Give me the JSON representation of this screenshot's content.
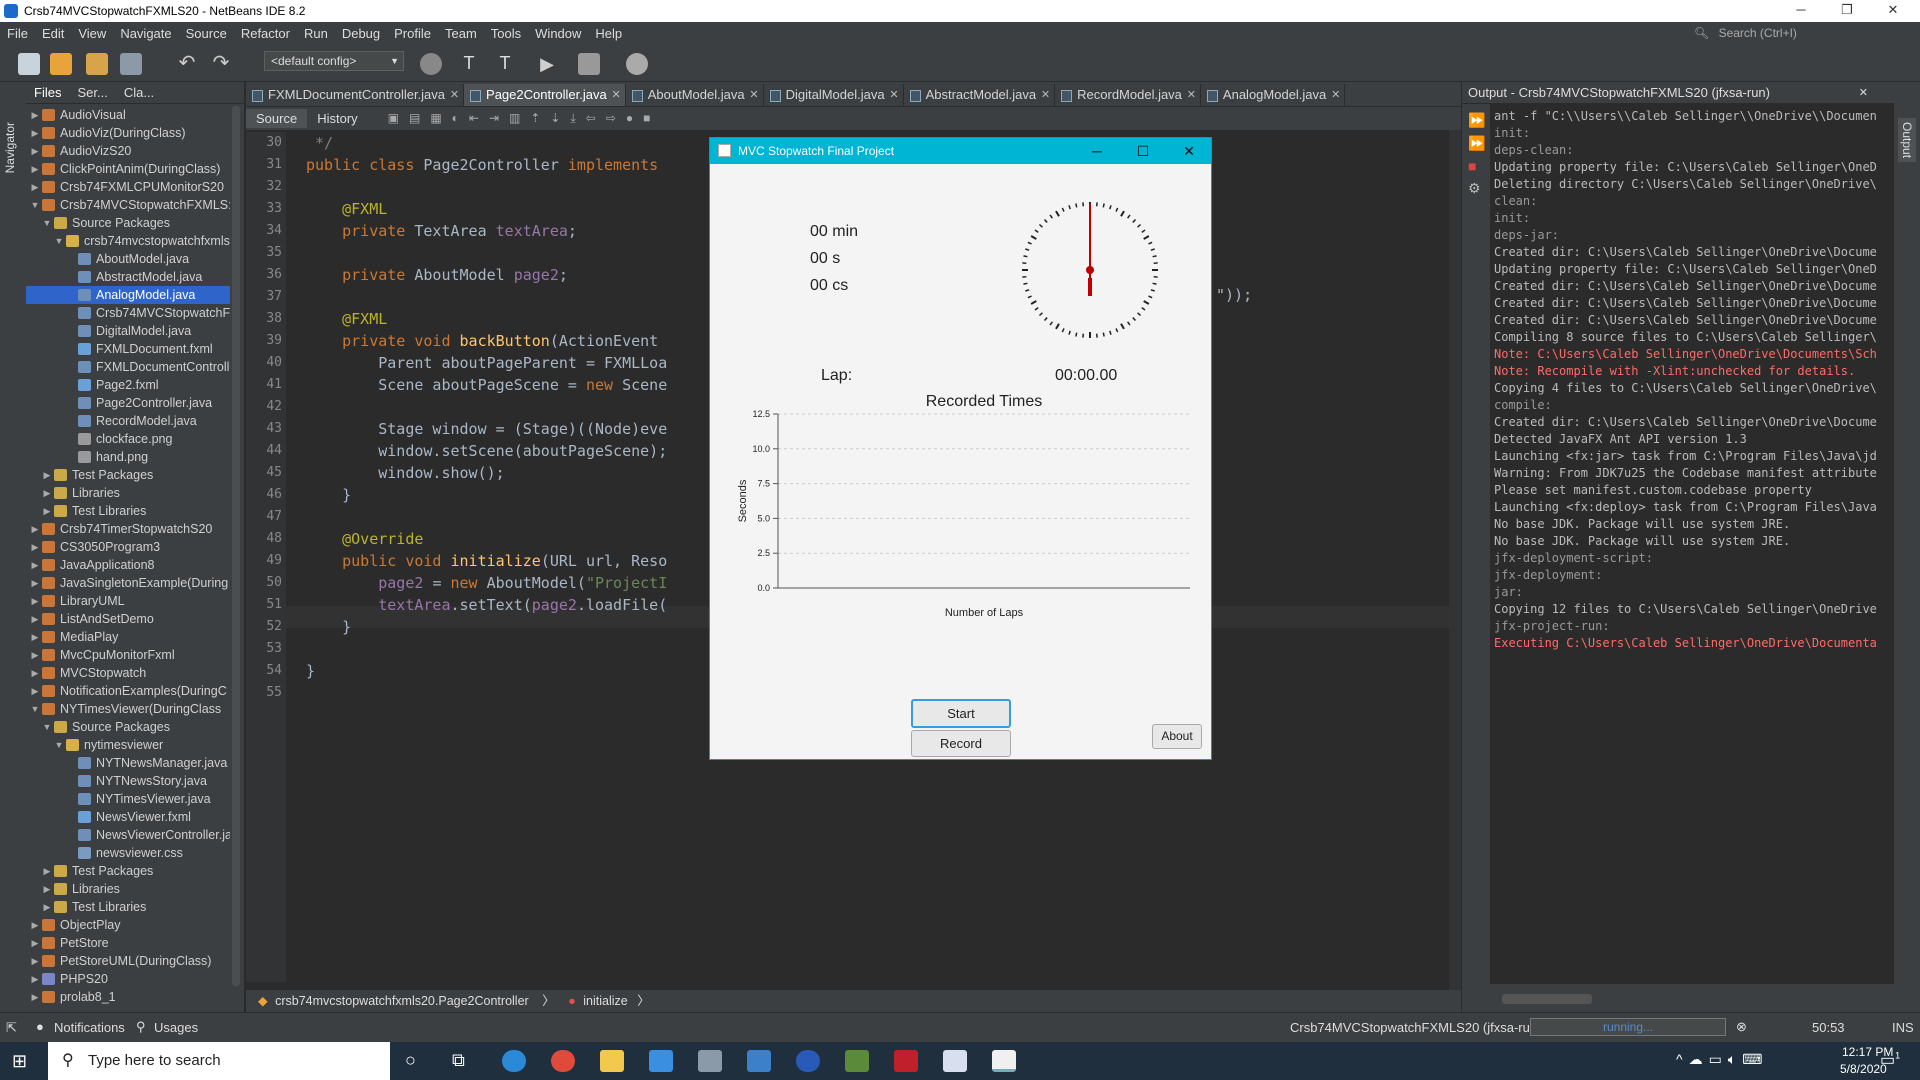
{
  "window": {
    "title": "Crsb74MVCStopwatchFXMLS20 - NetBeans IDE 8.2"
  },
  "menu": [
    "File",
    "Edit",
    "View",
    "Navigate",
    "Source",
    "Refactor",
    "Run",
    "Debug",
    "Profile",
    "Team",
    "Tools",
    "Window",
    "Help"
  ],
  "search": {
    "placeholder": "Search (Ctrl+I)"
  },
  "toolbar": {
    "config": "<default config>"
  },
  "left_strip": {
    "navigator": "Navigator"
  },
  "project_tabs": [
    "Files",
    "Ser...",
    "Cla..."
  ],
  "tree": [
    {
      "label": "AudioVisual",
      "lvl": 0,
      "arrow": "▶",
      "icon": "project-icon"
    },
    {
      "label": "AudioViz(DuringClass)",
      "lvl": 0,
      "arrow": "▶",
      "icon": "project-icon"
    },
    {
      "label": "AudioVizS20",
      "lvl": 0,
      "arrow": "▶",
      "icon": "project-icon"
    },
    {
      "label": "ClickPointAnim(DuringClass)",
      "lvl": 0,
      "arrow": "▶",
      "icon": "project-icon"
    },
    {
      "label": "Crsb74FXMLCPUMonitorS20",
      "lvl": 0,
      "arrow": "▶",
      "icon": "project-icon"
    },
    {
      "label": "Crsb74MVCStopwatchFXMLS:",
      "lvl": 0,
      "arrow": "▼",
      "icon": "project-icon"
    },
    {
      "label": "Source Packages",
      "lvl": 1,
      "arrow": "▼",
      "icon": "folder-icon"
    },
    {
      "label": "crsb74mvcstopwatchfxmls:",
      "lvl": 2,
      "arrow": "▼",
      "icon": "package-icon"
    },
    {
      "label": "AboutModel.java",
      "lvl": 3,
      "arrow": "",
      "icon": "java-file-icon"
    },
    {
      "label": "AbstractModel.java",
      "lvl": 3,
      "arrow": "",
      "icon": "java-file-icon"
    },
    {
      "label": "AnalogModel.java",
      "lvl": 3,
      "arrow": "",
      "icon": "java-file-icon",
      "sel": true
    },
    {
      "label": "Crsb74MVCStopwatchFX",
      "lvl": 3,
      "arrow": "",
      "icon": "java-file-icon"
    },
    {
      "label": "DigitalModel.java",
      "lvl": 3,
      "arrow": "",
      "icon": "java-file-icon"
    },
    {
      "label": "FXMLDocument.fxml",
      "lvl": 3,
      "arrow": "",
      "icon": "fxml-file-icon"
    },
    {
      "label": "FXMLDocumentControlle",
      "lvl": 3,
      "arrow": "",
      "icon": "java-file-icon"
    },
    {
      "label": "Page2.fxml",
      "lvl": 3,
      "arrow": "",
      "icon": "fxml-file-icon"
    },
    {
      "label": "Page2Controller.java",
      "lvl": 3,
      "arrow": "",
      "icon": "java-file-icon"
    },
    {
      "label": "RecordModel.java",
      "lvl": 3,
      "arrow": "",
      "icon": "java-file-icon"
    },
    {
      "label": "clockface.png",
      "lvl": 3,
      "arrow": "",
      "icon": "image-file-icon"
    },
    {
      "label": "hand.png",
      "lvl": 3,
      "arrow": "",
      "icon": "image-file-icon"
    },
    {
      "label": "Test Packages",
      "lvl": 1,
      "arrow": "▶",
      "icon": "folder-icon"
    },
    {
      "label": "Libraries",
      "lvl": 1,
      "arrow": "▶",
      "icon": "folder-icon"
    },
    {
      "label": "Test Libraries",
      "lvl": 1,
      "arrow": "▶",
      "icon": "folder-icon"
    },
    {
      "label": "Crsb74TimerStopwatchS20",
      "lvl": 0,
      "arrow": "▶",
      "icon": "project-icon"
    },
    {
      "label": "CS3050Program3",
      "lvl": 0,
      "arrow": "▶",
      "icon": "project-icon"
    },
    {
      "label": "JavaApplication8",
      "lvl": 0,
      "arrow": "▶",
      "icon": "project-icon"
    },
    {
      "label": "JavaSingletonExample(During",
      "lvl": 0,
      "arrow": "▶",
      "icon": "project-icon"
    },
    {
      "label": "LibraryUML",
      "lvl": 0,
      "arrow": "▶",
      "icon": "project-icon"
    },
    {
      "label": "ListAndSetDemo",
      "lvl": 0,
      "arrow": "▶",
      "icon": "project-icon"
    },
    {
      "label": "MediaPlay",
      "lvl": 0,
      "arrow": "▶",
      "icon": "project-icon"
    },
    {
      "label": "MvcCpuMonitorFxml",
      "lvl": 0,
      "arrow": "▶",
      "icon": "project-icon"
    },
    {
      "label": "MVCStopwatch",
      "lvl": 0,
      "arrow": "▶",
      "icon": "project-icon"
    },
    {
      "label": "NotificationExamples(DuringC",
      "lvl": 0,
      "arrow": "▶",
      "icon": "project-icon"
    },
    {
      "label": "NYTimesViewer(DuringClass",
      "lvl": 0,
      "arrow": "▼",
      "icon": "project-icon"
    },
    {
      "label": "Source Packages",
      "lvl": 1,
      "arrow": "▼",
      "icon": "folder-icon"
    },
    {
      "label": "nytimesviewer",
      "lvl": 2,
      "arrow": "▼",
      "icon": "package-icon"
    },
    {
      "label": "NYTNewsManager.java",
      "lvl": 3,
      "arrow": "",
      "icon": "java-file-icon"
    },
    {
      "label": "NYTNewsStory.java",
      "lvl": 3,
      "arrow": "",
      "icon": "java-file-icon"
    },
    {
      "label": "NYTimesViewer.java",
      "lvl": 3,
      "arrow": "",
      "icon": "java-file-icon"
    },
    {
      "label": "NewsViewer.fxml",
      "lvl": 3,
      "arrow": "",
      "icon": "fxml-file-icon"
    },
    {
      "label": "NewsViewerController.ja",
      "lvl": 3,
      "arrow": "",
      "icon": "java-file-icon"
    },
    {
      "label": "newsviewer.css",
      "lvl": 3,
      "arrow": "",
      "icon": "css-file-icon"
    },
    {
      "label": "Test Packages",
      "lvl": 1,
      "arrow": "▶",
      "icon": "folder-icon"
    },
    {
      "label": "Libraries",
      "lvl": 1,
      "arrow": "▶",
      "icon": "folder-icon"
    },
    {
      "label": "Test Libraries",
      "lvl": 1,
      "arrow": "▶",
      "icon": "folder-icon"
    },
    {
      "label": "ObjectPlay",
      "lvl": 0,
      "arrow": "▶",
      "icon": "project-icon"
    },
    {
      "label": "PetStore",
      "lvl": 0,
      "arrow": "▶",
      "icon": "project-icon"
    },
    {
      "label": "PetStoreUML(DuringClass)",
      "lvl": 0,
      "arrow": "▶",
      "icon": "project-icon"
    },
    {
      "label": "PHPS20",
      "lvl": 0,
      "arrow": "▶",
      "icon": "php-project-icon"
    },
    {
      "label": "prolab8_1",
      "lvl": 0,
      "arrow": "▶",
      "icon": "project-icon"
    }
  ],
  "editor_tabs": [
    {
      "label": "FXMLDocumentController.java"
    },
    {
      "label": "Page2Controller.java",
      "active": true
    },
    {
      "label": "AboutModel.java"
    },
    {
      "label": "DigitalModel.java"
    },
    {
      "label": "AbstractModel.java"
    },
    {
      "label": "RecordModel.java"
    },
    {
      "label": "AnalogModel.java"
    }
  ],
  "editor_toolbar": {
    "source": "Source",
    "history": "History"
  },
  "code_lines": [
    {
      "n": "30",
      "t": [
        [
          "cm",
          " */"
        ]
      ]
    },
    {
      "n": "31",
      "t": [
        [
          "kw",
          "public class "
        ],
        [
          "tx2",
          "Page2Controller "
        ],
        [
          "kw",
          "implements"
        ]
      ]
    },
    {
      "n": "32",
      "t": []
    },
    {
      "n": "33",
      "t": [
        [
          "an",
          "    @FXML"
        ]
      ]
    },
    {
      "n": "34",
      "t": [
        [
          "kw",
          "    private "
        ],
        [
          "tx2",
          "TextArea "
        ],
        [
          "fd",
          "textArea"
        ],
        [
          "tx2",
          ";"
        ]
      ]
    },
    {
      "n": "35",
      "t": []
    },
    {
      "n": "36",
      "t": [
        [
          "kw",
          "    private "
        ],
        [
          "tx2",
          "AboutModel "
        ],
        [
          "fd",
          "page2"
        ],
        [
          "tx2",
          ";"
        ]
      ]
    },
    {
      "n": "37",
      "t": []
    },
    {
      "n": "38",
      "t": [
        [
          "an",
          "    @FXML"
        ]
      ]
    },
    {
      "n": "39",
      "t": [
        [
          "kw",
          "    private void "
        ],
        [
          "mt",
          "backButton"
        ],
        [
          "tx2",
          "(ActionEvent"
        ]
      ]
    },
    {
      "n": "40",
      "t": [
        [
          "tx2",
          "        Parent aboutPageParent = FXMLLoa"
        ]
      ]
    },
    {
      "n": "41",
      "t": [
        [
          "tx2",
          "        Scene aboutPageScene = "
        ],
        [
          "kw",
          "new "
        ],
        [
          "tx2",
          "Scene"
        ]
      ]
    },
    {
      "n": "42",
      "t": []
    },
    {
      "n": "43",
      "t": [
        [
          "tx2",
          "        Stage window = (Stage)((Node)eve"
        ]
      ]
    },
    {
      "n": "44",
      "t": [
        [
          "tx2",
          "        window.setScene(aboutPageScene);"
        ]
      ]
    },
    {
      "n": "45",
      "t": [
        [
          "tx2",
          "        window.show();"
        ]
      ]
    },
    {
      "n": "46",
      "t": [
        [
          "tx2",
          "    }"
        ]
      ]
    },
    {
      "n": "47",
      "t": []
    },
    {
      "n": "48",
      "t": [
        [
          "an",
          "    @Override"
        ]
      ]
    },
    {
      "n": "49",
      "t": [
        [
          "kw",
          "    public void "
        ],
        [
          "mt",
          "initialize"
        ],
        [
          "tx2",
          "(URL url, Reso"
        ]
      ]
    },
    {
      "n": "50",
      "t": [
        [
          "fd",
          "        page2 "
        ],
        [
          "tx2",
          "= "
        ],
        [
          "kw",
          "new "
        ],
        [
          "tx2",
          "AboutModel("
        ],
        [
          "st",
          "\"ProjectI"
        ]
      ]
    },
    {
      "n": "51",
      "t": [
        [
          "fd",
          "        textArea"
        ],
        [
          "tx2",
          ".setText("
        ],
        [
          "fd",
          "page2"
        ],
        [
          "tx2",
          ".loadFile("
        ]
      ]
    },
    {
      "n": "52",
      "t": [
        [
          "tx2",
          "    }"
        ]
      ]
    },
    {
      "n": "53",
      "t": []
    },
    {
      "n": "54",
      "t": [
        [
          "tx2",
          "}"
        ]
      ]
    },
    {
      "n": "55",
      "t": []
    }
  ],
  "code_tail_40": "\"));",
  "breadcrumb": {
    "class": "crsb74mvcstopwatchfxmls20.Page2Controller",
    "method": "initialize"
  },
  "output": {
    "title": "Output - Crsb74MVCStopwatchFXMLS20 (jfxsa-run)",
    "lines": [
      {
        "t": "ant -f \"C:\\\\Users\\\\Caleb Sellinger\\\\OneDrive\\\\Documen",
        "c": ""
      },
      {
        "t": "init:",
        "c": "gry"
      },
      {
        "t": "deps-clean:",
        "c": "gry"
      },
      {
        "t": "Updating property file: C:\\Users\\Caleb Sellinger\\OneD",
        "c": ""
      },
      {
        "t": "Deleting directory C:\\Users\\Caleb Sellinger\\OneDrive\\",
        "c": ""
      },
      {
        "t": "clean:",
        "c": "gry"
      },
      {
        "t": "init:",
        "c": "gry"
      },
      {
        "t": "deps-jar:",
        "c": "gry"
      },
      {
        "t": "Created dir: C:\\Users\\Caleb Sellinger\\OneDrive\\Docume",
        "c": ""
      },
      {
        "t": "Updating property file: C:\\Users\\Caleb Sellinger\\OneD",
        "c": ""
      },
      {
        "t": "Created dir: C:\\Users\\Caleb Sellinger\\OneDrive\\Docume",
        "c": ""
      },
      {
        "t": "Created dir: C:\\Users\\Caleb Sellinger\\OneDrive\\Docume",
        "c": ""
      },
      {
        "t": "Created dir: C:\\Users\\Caleb Sellinger\\OneDrive\\Docume",
        "c": ""
      },
      {
        "t": "Compiling 8 source files to C:\\Users\\Caleb Sellinger\\",
        "c": ""
      },
      {
        "t": "Note: C:\\Users\\Caleb Sellinger\\OneDrive\\Documents\\Sch",
        "c": "red"
      },
      {
        "t": "Note: Recompile with -Xlint:unchecked for details.",
        "c": "red"
      },
      {
        "t": "Copying 4 files to C:\\Users\\Caleb Sellinger\\OneDrive\\",
        "c": ""
      },
      {
        "t": "compile:",
        "c": "gry"
      },
      {
        "t": "Created dir: C:\\Users\\Caleb Sellinger\\OneDrive\\Docume",
        "c": ""
      },
      {
        "t": "Detected JavaFX Ant API version 1.3",
        "c": ""
      },
      {
        "t": "Launching <fx:jar> task from C:\\Program Files\\Java\\jd",
        "c": ""
      },
      {
        "t": "Warning: From JDK7u25 the Codebase manifest attribute",
        "c": ""
      },
      {
        "t": "         Please set manifest.custom.codebase property",
        "c": ""
      },
      {
        "t": "Launching <fx:deploy> task from C:\\Program Files\\Java",
        "c": ""
      },
      {
        "t": "No base JDK. Package will use system JRE.",
        "c": ""
      },
      {
        "t": "No base JDK. Package will use system JRE.",
        "c": ""
      },
      {
        "t": "jfx-deployment-script:",
        "c": "gry"
      },
      {
        "t": "jfx-deployment:",
        "c": "gry"
      },
      {
        "t": "jar:",
        "c": "gry"
      },
      {
        "t": "Copying 12 files to C:\\Users\\Caleb Sellinger\\OneDrive",
        "c": ""
      },
      {
        "t": "jfx-project-run:",
        "c": "gry"
      },
      {
        "t": "Executing C:\\Users\\Caleb Sellinger\\OneDrive\\Documenta",
        "c": "red"
      }
    ]
  },
  "right_strip": {
    "output": "Output"
  },
  "status": {
    "notifications": "Notifications",
    "usages": "Usages",
    "run": "Crsb74MVCStopwatchFXMLS20 (jfxsa-run)",
    "progress": "running...",
    "pos": "50:53",
    "mode": "INS"
  },
  "taskbar": {
    "search": "Type here to search",
    "time": "12:17 PM",
    "date": "5/8/2020",
    "notif": "1"
  },
  "dialog": {
    "title": "MVC Stopwatch Final Project",
    "min": "00 min",
    "sec": "00 s",
    "cs": "00 cs",
    "lap_label": "Lap:",
    "lap_value": "00:00.00",
    "start": "Start",
    "record": "Record",
    "about": "About"
  },
  "chart_data": {
    "type": "line",
    "title": "Recorded Times",
    "xlabel": "Number of Laps",
    "ylabel": "Seconds",
    "ylim": [
      0,
      12.5
    ],
    "yticks": [
      "0.0",
      "2.5",
      "5.0",
      "7.5",
      "10.0",
      "12.5"
    ],
    "series": [],
    "grid": true
  },
  "colors": {
    "accent": "#00b4d4",
    "selection": "#2f65ca",
    "hand": "#c00000"
  }
}
